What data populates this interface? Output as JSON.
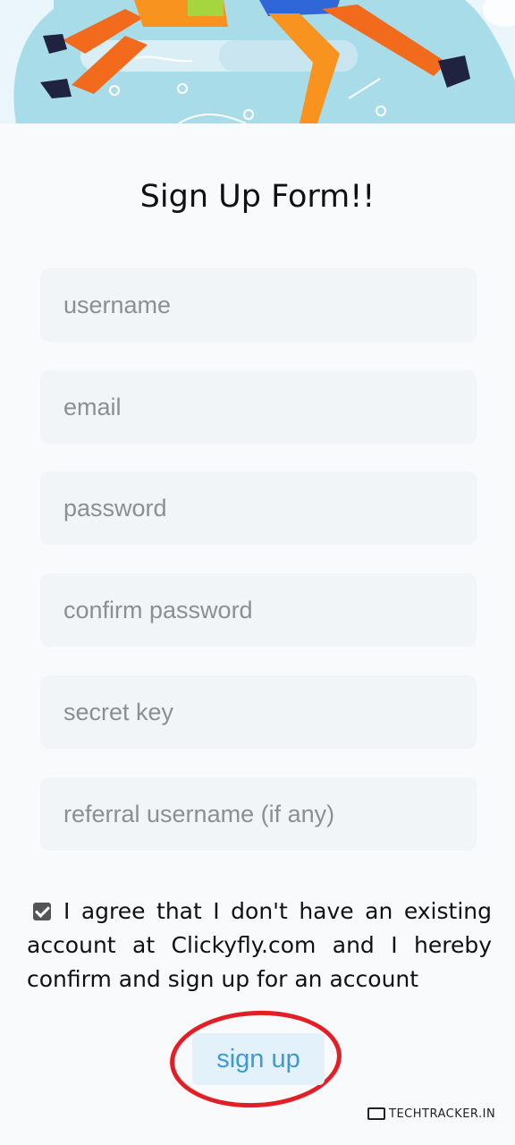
{
  "form": {
    "title": "Sign Up Form!!",
    "fields": [
      {
        "name": "username",
        "placeholder": "username"
      },
      {
        "name": "email",
        "placeholder": "email"
      },
      {
        "name": "password",
        "placeholder": "password"
      },
      {
        "name": "confirm_password",
        "placeholder": "confirm password"
      },
      {
        "name": "secret_key",
        "placeholder": "secret key"
      },
      {
        "name": "referral",
        "placeholder": "referral username (if any)"
      }
    ],
    "agreement": {
      "checked": true,
      "text": "I agree that I don't have an existing account at Clickyfly.com and I hereby confirm and sign up for an account"
    },
    "submit_label": "sign up"
  },
  "watermark": "TECHTRACKER.IN",
  "colors": {
    "hero_bg": "#a9dce9",
    "field_bg": "#f1f5f8",
    "button_bg": "#e3f1fb",
    "button_text": "#3c9ad6",
    "highlight": "#e41e25"
  }
}
